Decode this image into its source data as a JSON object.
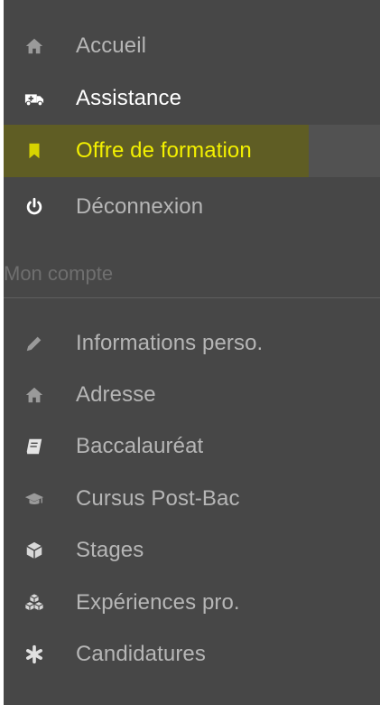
{
  "colors": {
    "sidebar_bg": "#474747",
    "text": "#b6b6b6",
    "bright_text": "#ffffff",
    "active_text": "#f3f000",
    "active_highlight": "#5f5d24",
    "section_title": "#6f6f6f"
  },
  "nav": {
    "items": [
      {
        "label": "Accueil",
        "icon": "home-icon"
      },
      {
        "label": "Assistance",
        "icon": "ambulance-icon"
      },
      {
        "label": "Offre de formation",
        "icon": "bookmark-icon"
      },
      {
        "label": "Déconnexion",
        "icon": "power-icon"
      }
    ]
  },
  "account": {
    "title": "Mon compte",
    "items": [
      {
        "label": "Informations perso.",
        "icon": "pencil-icon"
      },
      {
        "label": "Adresse",
        "icon": "home-icon"
      },
      {
        "label": "Baccalauréat",
        "icon": "book-icon"
      },
      {
        "label": "Cursus Post-Bac",
        "icon": "graduation-cap-icon"
      },
      {
        "label": "Stages",
        "icon": "cube-icon"
      },
      {
        "label": "Expériences pro.",
        "icon": "cubes-icon"
      },
      {
        "label": "Candidatures",
        "icon": "asterisk-icon"
      }
    ]
  }
}
